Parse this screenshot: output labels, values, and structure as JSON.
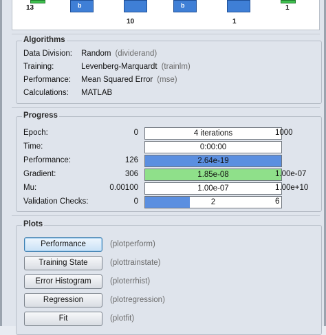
{
  "diagram": {
    "input_count": "13",
    "hidden_count": "10",
    "output_count": "1",
    "final_count": "1",
    "block_glyph": "b"
  },
  "algorithms": {
    "title": "Algorithms",
    "rows": [
      {
        "key": "Data Division:",
        "value": "Random",
        "hint": "(dividerand)"
      },
      {
        "key": "Training:",
        "value": "Levenberg-Marquardt",
        "hint": "(trainlm)"
      },
      {
        "key": "Performance:",
        "value": "Mean Squared Error",
        "hint": "(mse)"
      },
      {
        "key": "Calculations:",
        "value": "MATLAB",
        "hint": ""
      }
    ]
  },
  "progress": {
    "title": "Progress",
    "rows": [
      {
        "key": "Epoch:",
        "start": "0",
        "bar": "4 iterations",
        "end": "1000",
        "fill": 0,
        "color": "#ffffff"
      },
      {
        "key": "Time:",
        "start": "",
        "bar": "0:00:00",
        "end": "",
        "fill": 0,
        "color": "#ffffff"
      },
      {
        "key": "Performance:",
        "start": "126",
        "bar": "2.64e-19",
        "end": "",
        "fill": 1.0,
        "color": "#5b8fe0"
      },
      {
        "key": "Gradient:",
        "start": "306",
        "bar": "1.85e-08",
        "end": "1.00e-07",
        "fill": 1.0,
        "color": "#8fe08a"
      },
      {
        "key": "Mu:",
        "start": "0.00100",
        "bar": "1.00e-07",
        "end": "1.00e+10",
        "fill": 0,
        "color": "#ffffff"
      },
      {
        "key": "Validation Checks:",
        "start": "0",
        "bar": "2",
        "end": "6",
        "fill": 0.33,
        "color": "#5b8fe0"
      }
    ]
  },
  "plots": {
    "title": "Plots",
    "buttons": [
      {
        "label": "Performance",
        "hint": "(plotperform)"
      },
      {
        "label": "Training State",
        "hint": "(plottrainstate)"
      },
      {
        "label": "Error Histogram",
        "hint": "(ploterrhist)"
      },
      {
        "label": "Regression",
        "hint": "(plotregression)"
      },
      {
        "label": "Fit",
        "hint": "(plotfit)"
      }
    ]
  }
}
